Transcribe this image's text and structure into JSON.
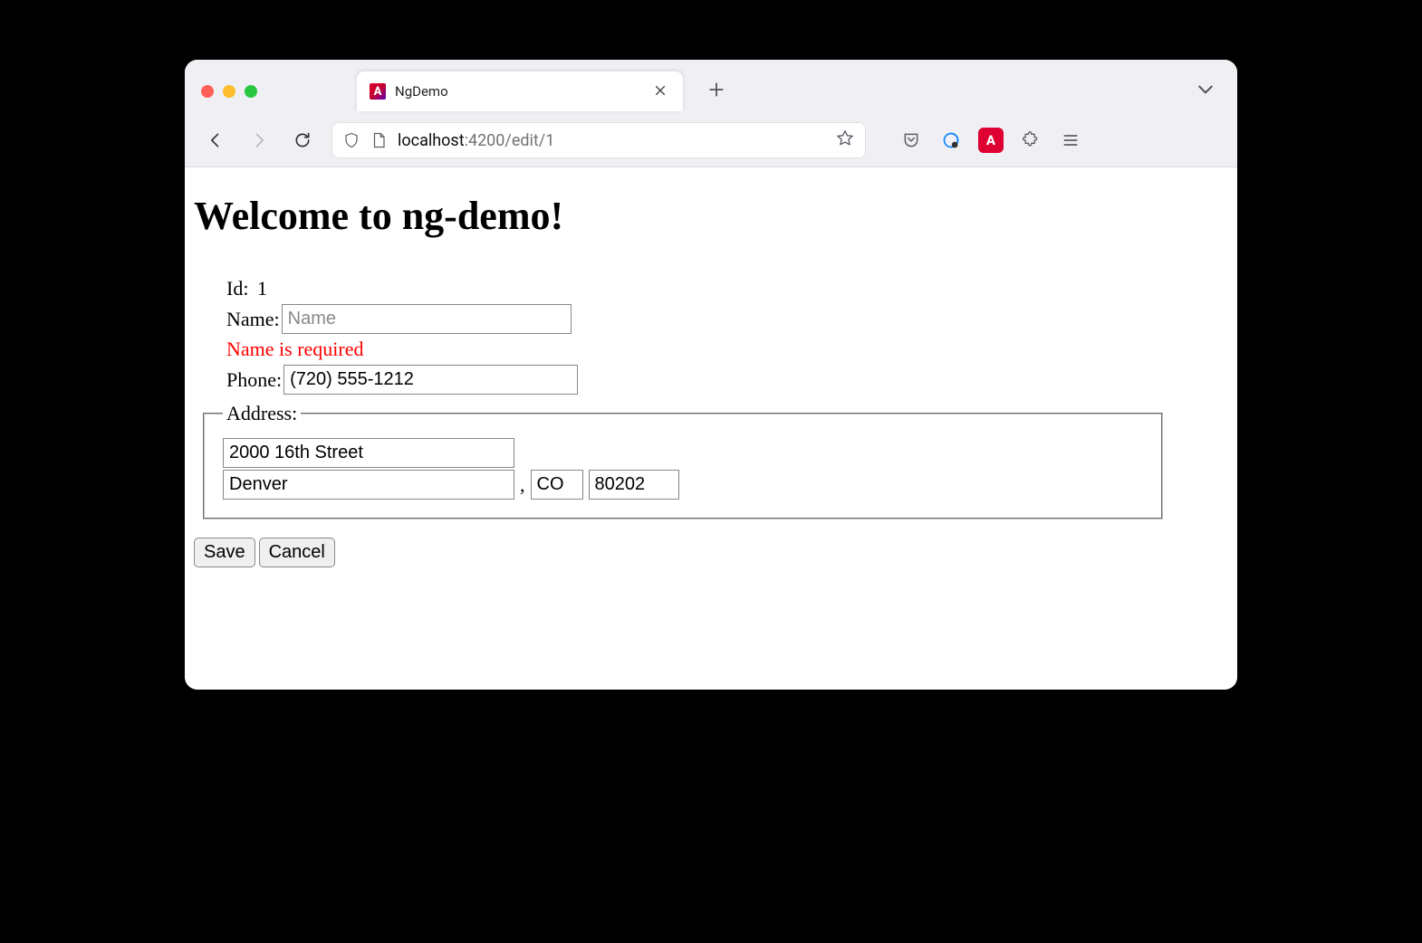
{
  "browser": {
    "tab_title": "NgDemo",
    "favicon_letter": "A",
    "url_host": "localhost",
    "url_path": ":4200/edit/1"
  },
  "page": {
    "heading": "Welcome to ng-demo!"
  },
  "form": {
    "id_label": "Id:",
    "id_value": "1",
    "name_label": "Name:",
    "name_placeholder": "Name",
    "name_value": "",
    "name_error": "Name is required",
    "phone_label": "Phone:",
    "phone_value": "(720) 555-1212",
    "address_legend": "Address:",
    "street_value": "2000 16th Street",
    "city_value": "Denver",
    "state_value": "CO",
    "zip_value": "80202",
    "comma": ","
  },
  "buttons": {
    "save": "Save",
    "cancel": "Cancel"
  }
}
